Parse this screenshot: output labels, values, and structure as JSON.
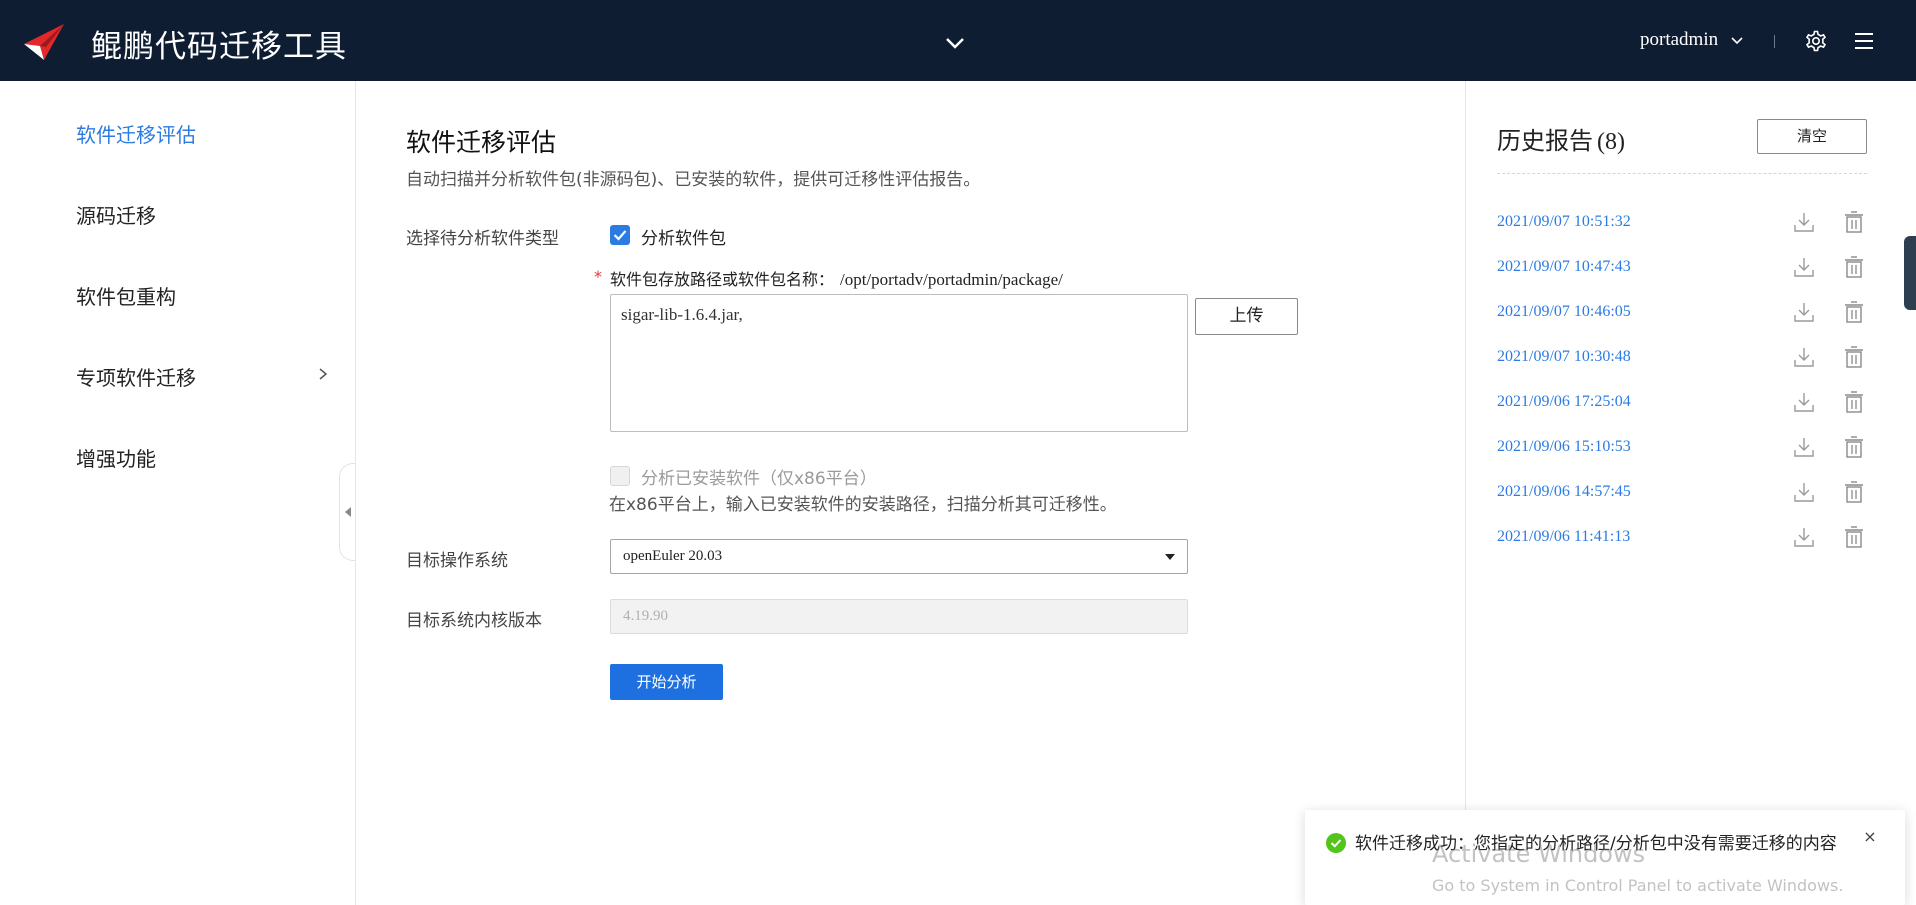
{
  "header": {
    "app_title": "鲲鹏代码迁移工具",
    "username": "portadmin",
    "colors": {
      "background": "#0f1d33",
      "logo_red": "#e3282c"
    }
  },
  "sidebar": {
    "items": [
      {
        "label": "软件迁移评估",
        "active": true
      },
      {
        "label": "源码迁移"
      },
      {
        "label": "软件包重构"
      },
      {
        "label": "专项软件迁移",
        "has_submenu": true
      },
      {
        "label": "增强功能"
      }
    ]
  },
  "main": {
    "title": "软件迁移评估",
    "description": "自动扫描并分析软件包(非源码包)、已安装的软件，提供可迁移性评估报告。",
    "type_label": "选择待分析软件类型",
    "analyze_package": {
      "label": "分析软件包",
      "checked": true
    },
    "path_label": "软件包存放路径或软件包名称：",
    "path_value": "/opt/portadv/portadmin/package/",
    "package_textarea_value": "sigar-lib-1.6.4.jar,",
    "upload_label": "上传",
    "analyze_installed": {
      "label": "分析已安装软件（仅x86平台）",
      "checked": false,
      "disabled": true
    },
    "installed_hint": "在x86平台上，输入已安装软件的安装路径，扫描分析其可迁移性。",
    "target_os_label": "目标操作系统",
    "target_os_value": "openEuler 20.03",
    "kernel_label": "目标系统内核版本",
    "kernel_value": "4.19.90",
    "start_label": "开始分析",
    "accent_color": "#1e70e0"
  },
  "history": {
    "title": "历史报告",
    "count": "(8)",
    "clear_label": "清空",
    "reports": [
      "2021/09/07 10:51:32",
      "2021/09/07 10:47:43",
      "2021/09/07 10:46:05",
      "2021/09/07 10:30:48",
      "2021/09/06 17:25:04",
      "2021/09/06 15:10:53",
      "2021/09/06 14:57:45",
      "2021/09/06 11:41:13"
    ],
    "icons": [
      "download-icon",
      "trash-icon"
    ]
  },
  "toast": {
    "message": "软件迁移成功：您指定的分析路径/分析包中没有需要迁移的内容",
    "close_label": "×",
    "icon": "success-check-icon",
    "status_color": "#52c41a"
  },
  "watermark": {
    "title": "Activate Windows",
    "subtitle": "Go to System in Control Panel to activate Windows."
  }
}
